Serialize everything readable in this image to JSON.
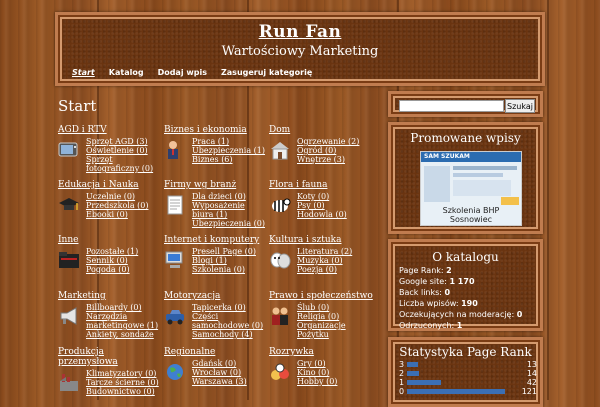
{
  "header": {
    "title": "Run Fan",
    "subtitle": "Wartościowy Marketing"
  },
  "nav": [
    {
      "label": "Start",
      "active": true
    },
    {
      "label": "Katalog"
    },
    {
      "label": "Dodaj wpis"
    },
    {
      "label": "Zasugeruj kategorię"
    }
  ],
  "main": {
    "title": "Start",
    "categories": [
      {
        "title": "AGD i RTV",
        "icon": "tv-icon",
        "subs": [
          "Sprzęt AGD (3)",
          "Oświetlenie (0)",
          "Sprzęt",
          "fotograficzny (0)"
        ]
      },
      {
        "title": "Biznes i ekonomia",
        "icon": "businessman-icon",
        "subs": [
          "Praca (1)",
          "Ubezpieczenia (1)",
          "Biznes (6)"
        ]
      },
      {
        "title": "Dom",
        "icon": "house-icon",
        "subs": [
          "Ogrzewanie (2)",
          "Ogród (0)",
          "Wnętrze (3)"
        ]
      },
      {
        "title": "Edukacja i Nauka",
        "icon": "graduation-cap-icon",
        "subs": [
          "Uczelnie (0)",
          "Przedszkola (0)",
          "Ebooki (0)"
        ]
      },
      {
        "title": "Firmy wg branż",
        "icon": "document-icon",
        "subs": [
          "Dla dzieci (0)",
          "Wyposażenie",
          "biura (1)",
          "Ubezpieczenia (0)"
        ]
      },
      {
        "title": "Flora i fauna",
        "icon": "zebra-icon",
        "subs": [
          "Koty (0)",
          "Psy (0)",
          "Hodowla (0)"
        ]
      },
      {
        "title": "Inne",
        "icon": "folder-icon",
        "subs": [
          "Pozostałe (1)",
          "Sennik (0)",
          "Pogoda (0)"
        ]
      },
      {
        "title": "Internet i komputery",
        "icon": "computer-icon",
        "subs": [
          "Presell Page (0)",
          "Blogi (1)",
          "Szkolenia (0)"
        ]
      },
      {
        "title": "Kultura i sztuka",
        "icon": "theater-masks-icon",
        "subs": [
          "Literatura (2)",
          "Muzyka (0)",
          "Poezja (0)"
        ]
      },
      {
        "title": "Marketing",
        "icon": "megaphone-icon",
        "subs": [
          "Billboardy (0)",
          "Narzędzia",
          "marketingowe (1)",
          "Ankiety, sondaże"
        ]
      },
      {
        "title": "Motoryzacja",
        "icon": "car-icon",
        "subs": [
          "Tapicerka (0)",
          "Części",
          "samochodowe (0)",
          "Samochody (4)"
        ]
      },
      {
        "title": "Prawo i społeczeństwo",
        "icon": "people-icon",
        "subs": [
          "Ślub (0)",
          "Religia (0)",
          "Organizacje",
          "Pożytku"
        ]
      },
      {
        "title": "Produkcja",
        "title2": "przemysłowa",
        "icon": "factory-icon",
        "subs": [
          "Klimatyzatory (0)",
          "Tarcze ścierne (0)",
          "Budownictwo (0)"
        ]
      },
      {
        "title": "Regionalne",
        "icon": "globe-icon",
        "subs": [
          "Gdańsk (0)",
          "Wrocław (0)",
          "Warszawa (3)"
        ]
      },
      {
        "title": "Rozrywka",
        "icon": "balls-icon",
        "subs": [
          "Gry (0)",
          "Kino (0)",
          "Hobby (0)"
        ]
      }
    ]
  },
  "search": {
    "placeholder": "",
    "button_label": "Szukaj"
  },
  "promo": {
    "title": "Promowane wpisy",
    "image_brand": "SAM SZUKAM",
    "caption_line1": "Szkolenia BHP",
    "caption_line2": "Sosnowiec"
  },
  "about": {
    "title": "O katalogu",
    "stats": [
      {
        "label": "Page Rank:",
        "value": "2"
      },
      {
        "label": "Google site:",
        "value": "1 170"
      },
      {
        "label": "Back links:",
        "value": "0"
      },
      {
        "label": "Liczba wpisów:",
        "value": "190"
      },
      {
        "label": "Oczekujących na moderację:",
        "value": "0"
      },
      {
        "label": "Odrzuconych:",
        "value": "1"
      }
    ]
  },
  "pagerank": {
    "title": "Statystyka Page Rank",
    "rows": [
      {
        "rank": "3",
        "count": "13",
        "fraction": 0.11
      },
      {
        "rank": "2",
        "count": "14",
        "fraction": 0.12
      },
      {
        "rank": "1",
        "count": "42",
        "fraction": 0.35
      },
      {
        "rank": "0",
        "count": "121",
        "fraction": 1.0
      }
    ]
  }
}
